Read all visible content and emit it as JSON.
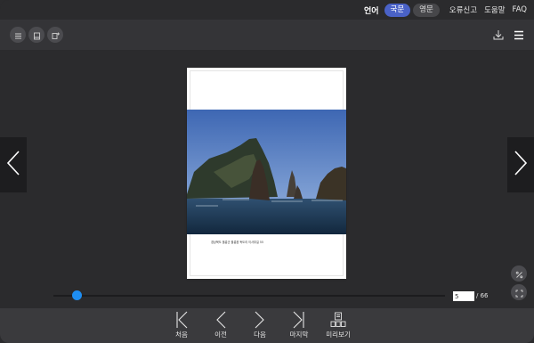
{
  "topbar": {
    "lang_label": "언어",
    "lang_korean": "국문",
    "lang_english": "영문",
    "report_error": "오류신고",
    "help": "도움말",
    "faq": "FAQ"
  },
  "icons": {
    "toc": "list-icon",
    "single_page": "single-page-icon",
    "bookmark": "bookmark-add-icon",
    "download": "download-icon",
    "menu": "hamburger-menu-icon",
    "prev": "chevron-left-icon",
    "next": "chevron-right-icon",
    "zoom": "zoom-percent-icon",
    "fullscreen": "fullscreen-icon"
  },
  "page": {
    "caption": "경상북도 울릉군 울릉읍 독도리 이사부길 55"
  },
  "progress": {
    "current_page": "5",
    "total_label": "/ 66",
    "position_fraction": 0.06
  },
  "bottombar": {
    "first": "처음",
    "prev": "이전",
    "next": "다음",
    "last": "마지막",
    "preview": "미리보기"
  },
  "colors": {
    "accent": "#4a62c7",
    "slider": "#1e8ef2",
    "background": "#2b2b2d"
  }
}
